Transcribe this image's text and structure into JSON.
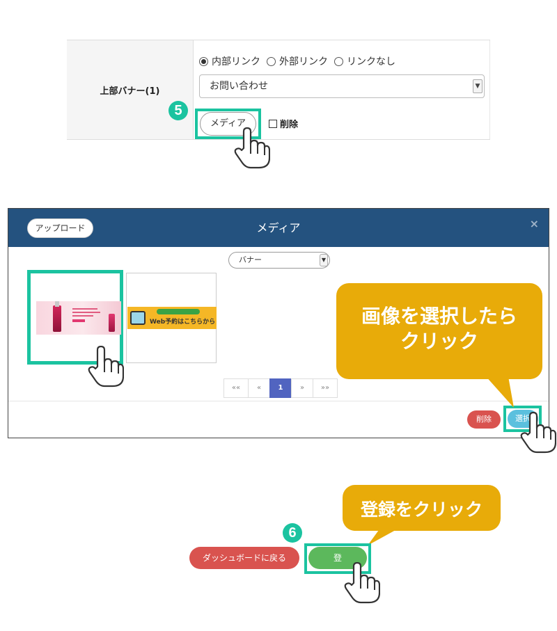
{
  "form": {
    "label": "上部バナー(1)",
    "radios": [
      {
        "label": "内部リンク",
        "checked": true
      },
      {
        "label": "外部リンク",
        "checked": false
      },
      {
        "label": "リンクなし",
        "checked": false
      }
    ],
    "select_value": "お問い合わせ",
    "media_button": "メディア",
    "delete_label": "削除"
  },
  "steps": {
    "step5": "5",
    "step6": "6"
  },
  "modal": {
    "title": "メディア",
    "upload_button": "アップロード",
    "close": "×",
    "category_select": "バナー",
    "thumb2_text": "Web予約はこちらから",
    "pagination": [
      "««",
      "«",
      "1",
      "»",
      "»»"
    ],
    "active_page": "1",
    "delete_button": "削除",
    "select_button": "選択"
  },
  "callouts": {
    "select_image_line1": "画像を選択したら",
    "select_image_line2": "クリック",
    "register_click": "登録をクリック"
  },
  "footer": {
    "dashboard_button": "ダッシュボードに戻る",
    "register_button": "登録"
  },
  "colors": {
    "highlight": "#1bc3a0",
    "callout": "#e8ab09",
    "modal_header": "#24527f",
    "danger": "#d9534f",
    "success": "#5cb85c",
    "info": "#5bc0de",
    "pager_active": "#5164c0"
  }
}
